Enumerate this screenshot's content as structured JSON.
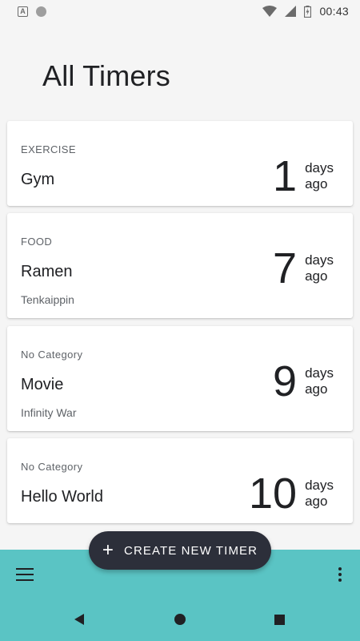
{
  "status_bar": {
    "time": "00:43",
    "left_icons": [
      "notification-a-icon",
      "circle-icon"
    ],
    "right_icons": [
      "wifi-icon",
      "signal-icon",
      "battery-icon"
    ]
  },
  "page": {
    "title": "All Timers"
  },
  "timers": [
    {
      "category": "EXERCISE",
      "title": "Gym",
      "subtitle": "",
      "count": "1",
      "unit_line1": "days",
      "unit_line2": "ago"
    },
    {
      "category": "FOOD",
      "title": "Ramen",
      "subtitle": "Tenkaippin",
      "count": "7",
      "unit_line1": "days",
      "unit_line2": "ago"
    },
    {
      "category": "No Category",
      "title": "Movie",
      "subtitle": "Infinity War",
      "count": "9",
      "unit_line1": "days",
      "unit_line2": "ago"
    },
    {
      "category": "No Category",
      "title": "Hello World",
      "subtitle": "",
      "count": "10",
      "unit_line1": "days",
      "unit_line2": "ago"
    }
  ],
  "fab": {
    "label": "CREATE NEW TIMER",
    "icon": "plus-icon"
  },
  "bottom_bar": {
    "menu_icon": "hamburger-menu-icon",
    "more_icon": "more-vert-icon",
    "color": "#5ac4c4"
  },
  "nav_bar": {
    "icons": [
      "back-icon",
      "home-icon",
      "recents-icon"
    ]
  }
}
